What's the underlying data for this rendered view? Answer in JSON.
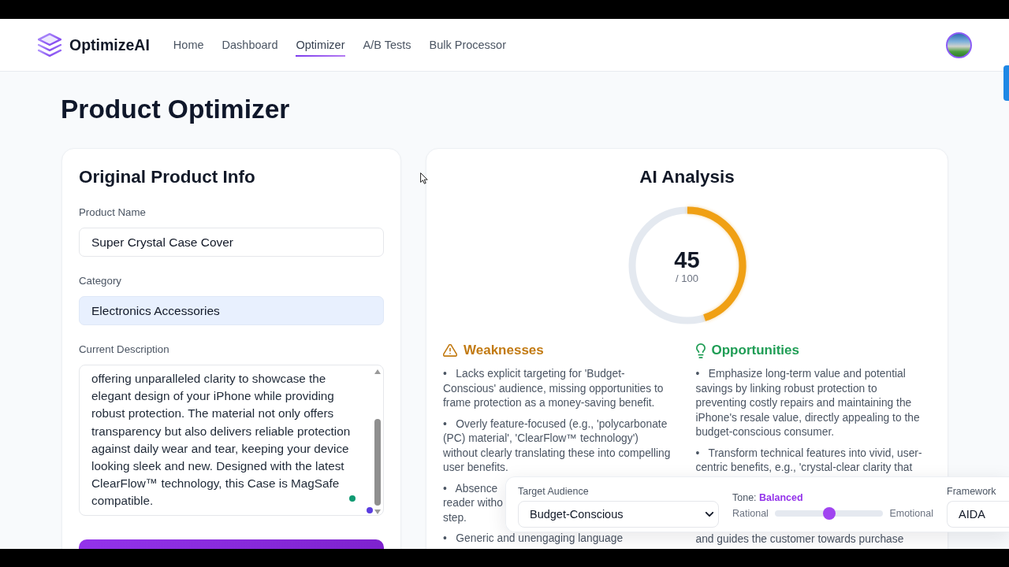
{
  "header": {
    "brand": "OptimizeAI",
    "nav": [
      {
        "label": "Home",
        "selected": false
      },
      {
        "label": "Dashboard",
        "selected": false
      },
      {
        "label": "Optimizer",
        "selected": true
      },
      {
        "label": "A/B Tests",
        "selected": false
      },
      {
        "label": "Bulk Processor",
        "selected": false
      }
    ]
  },
  "page_title": "Product Optimizer",
  "product_info": {
    "title": "Original Product Info",
    "fields": [
      {
        "kind": "input",
        "label": "Product Name",
        "value": "Super Crystal Case Cover",
        "autofilled": false
      },
      {
        "kind": "input",
        "label": "Category",
        "value": "Electronics Accessories",
        "autofilled": true
      },
      {
        "kind": "textarea",
        "label": "Current Description",
        "value": "offering unparalleled clarity to showcase the elegant design of your iPhone while providing robust protection. The material not only offers transparency but also delivers reliable protection against daily wear and tear, keeping your device looking sleek and new. Designed with the latest ClearFlow™ technology, this Case is MagSafe compatible."
      }
    ]
  },
  "analysis": {
    "title": "AI Analysis",
    "score": {
      "value": "45",
      "scale": "/ 100",
      "level": 0.45
    },
    "columns": [
      {
        "kind": "weaknesses",
        "title": "Weaknesses",
        "color": "#c27a12",
        "items": [
          {
            "text": "•   Lacks explicit targeting for 'Budget-Conscious' audience, missing opportunities to frame protection as a money-saving benefit."
          },
          {
            "text": "•   Overly feature-focused (e.g., 'polycarbonate (PC) material', 'ClearFlow™ technology') without clearly translating these into compelling user benefits."
          },
          {
            "text": "•   Absence\nreader witho\nstep."
          },
          {
            "text": "•   Generic and unengaging language"
          }
        ]
      },
      {
        "kind": "opportunities",
        "title": "Opportunities",
        "color": "#1f9d55",
        "items": [
          {
            "text": "•   Emphasize long-term value and potential savings by linking robust protection to preventing costly repairs and maintaining the iPhone's resale value, directly appealing to the budget-conscious consumer."
          },
          {
            "text": "•   Transform technical features into vivid, user-centric benefits, e.g., 'crystal-clear clarity that",
            "continuation": "and guides the customer towards purchase"
          }
        ]
      }
    ]
  },
  "settings_panel": {
    "audience": {
      "label": "Target Audience",
      "value": "Budget-Conscious"
    },
    "tone": {
      "label": "Tone: **Balanced**",
      "min_label": "Rational",
      "max_label": "Emotional",
      "level": 0.5
    },
    "framework": {
      "label": "Framework",
      "value": "AIDA"
    }
  }
}
